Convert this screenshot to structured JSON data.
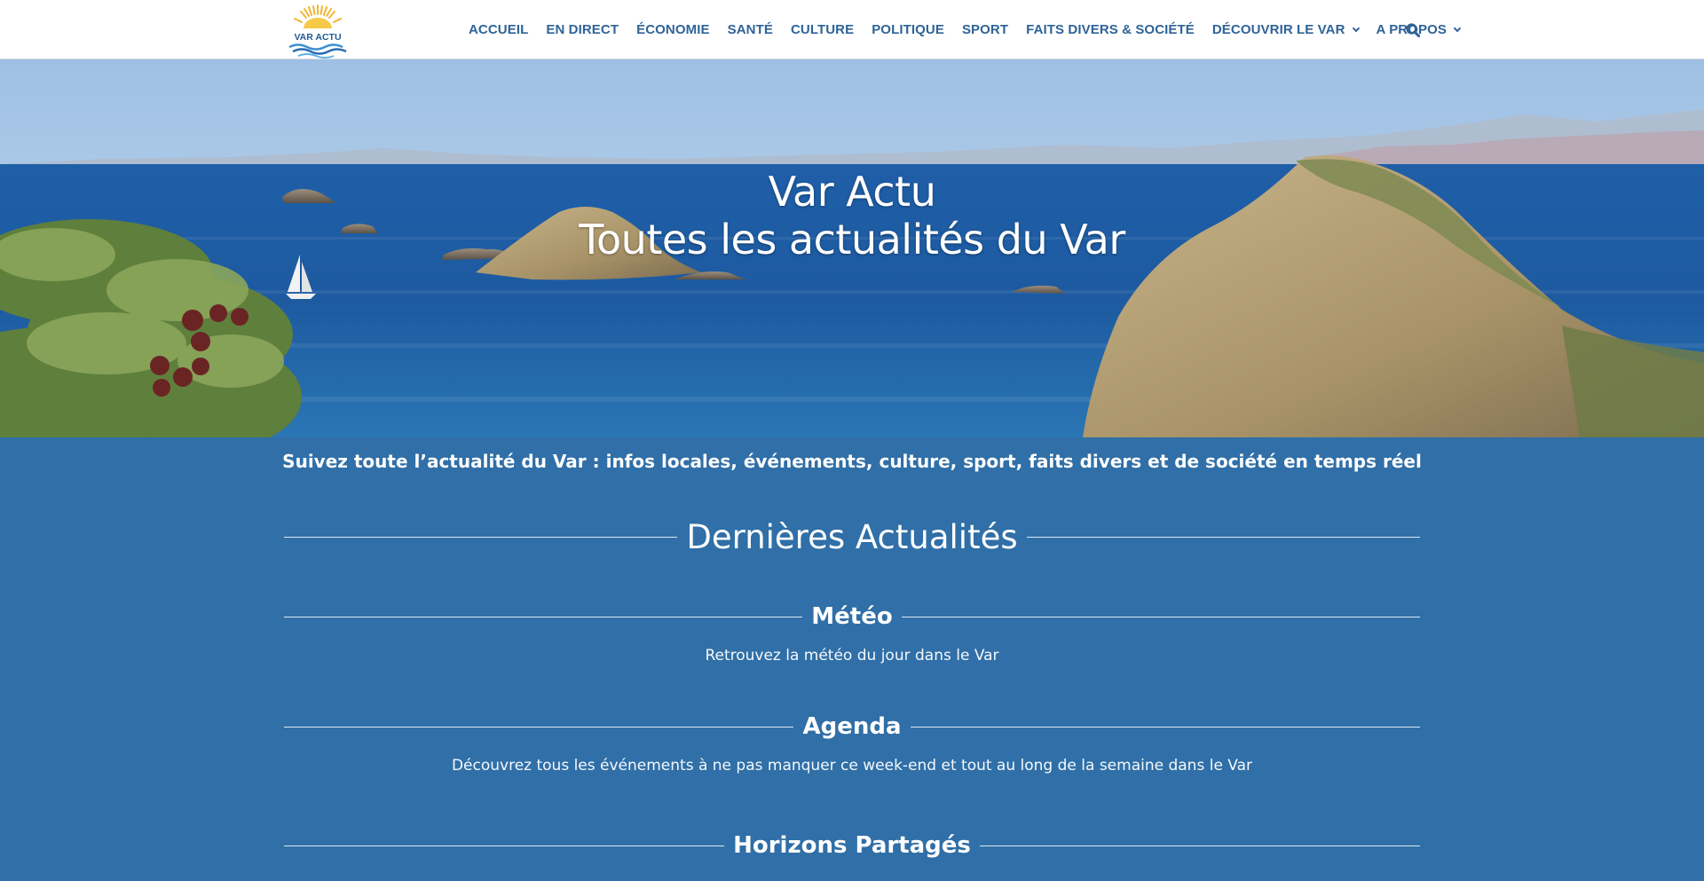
{
  "header": {
    "logo_text": "VAR ACTU",
    "nav": [
      {
        "label": "ACCUEIL",
        "has_dropdown": false
      },
      {
        "label": "EN DIRECT",
        "has_dropdown": false
      },
      {
        "label": "ÉCONOMIE",
        "has_dropdown": false
      },
      {
        "label": "SANTÉ",
        "has_dropdown": false
      },
      {
        "label": "CULTURE",
        "has_dropdown": false
      },
      {
        "label": "POLITIQUE",
        "has_dropdown": false
      },
      {
        "label": "SPORT",
        "has_dropdown": false
      },
      {
        "label": "FAITS DIVERS & SOCIÉTÉ",
        "has_dropdown": false
      },
      {
        "label": "DÉCOUVRIR LE VAR",
        "has_dropdown": true
      },
      {
        "label": "A PROPOS",
        "has_dropdown": true
      }
    ],
    "search_icon": "search-icon"
  },
  "hero": {
    "line1": "Var Actu",
    "line2": "Toutes les actualités du Var"
  },
  "tagline": "Suivez toute l’actualité du Var : infos locales, événements, culture, sport, faits divers et de société en temps réel",
  "main": {
    "heading": "Dernières Actualités",
    "sections": [
      {
        "title": "Météo",
        "description": "Retrouvez la météo du jour dans le Var"
      },
      {
        "title": "Agenda",
        "description": "Découvrez tous les événements à ne pas manquer ce week-end et tout au long de la semaine dans le Var"
      },
      {
        "title": "Horizons Partagés",
        "description": ""
      }
    ]
  },
  "colors": {
    "page_background": "#306fa7",
    "nav_text": "#2f6398",
    "header_background": "#ffffff"
  }
}
